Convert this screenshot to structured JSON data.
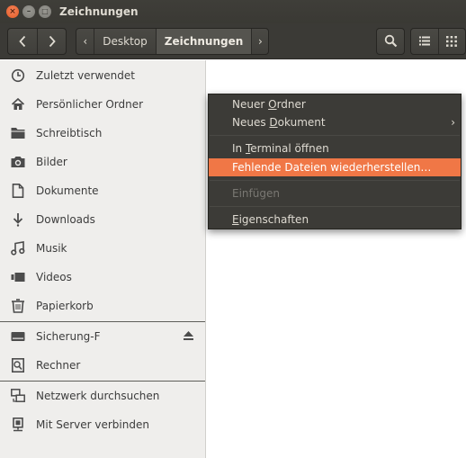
{
  "window": {
    "title": "Zeichnungen",
    "close_glyph": "×",
    "minimize_glyph": "–",
    "maximize_glyph": "□"
  },
  "toolbar": {
    "back_icon": "chevron-left-icon",
    "forward_icon": "chevron-right-icon",
    "path_left_glyph": "‹",
    "path_right_glyph": "›",
    "breadcrumbs": [
      "Desktop",
      "Zeichnungen"
    ],
    "active_crumb": "Zeichnungen",
    "search_icon": "search-icon",
    "list_view_icon": "list-view-icon",
    "grid_view_icon": "grid-view-icon"
  },
  "sidebar": {
    "items": [
      {
        "label": "Zuletzt verwendet",
        "icon": "clock-icon"
      },
      {
        "label": "Persönlicher Ordner",
        "icon": "home-icon"
      },
      {
        "label": "Schreibtisch",
        "icon": "folder-icon"
      },
      {
        "label": "Bilder",
        "icon": "camera-icon"
      },
      {
        "label": "Dokumente",
        "icon": "document-icon"
      },
      {
        "label": "Downloads",
        "icon": "download-icon"
      },
      {
        "label": "Musik",
        "icon": "music-icon"
      },
      {
        "label": "Videos",
        "icon": "video-icon"
      },
      {
        "label": "Papierkorb",
        "icon": "trash-icon"
      },
      {
        "label": "Sicherung-F",
        "icon": "drive-icon",
        "eject_icon": "eject-icon"
      },
      {
        "label": "Rechner",
        "icon": "computer-icon"
      },
      {
        "label": "Netzwerk durchsuchen",
        "icon": "network-icon"
      },
      {
        "label": "Mit Server verbinden",
        "icon": "server-icon"
      }
    ]
  },
  "context_menu": {
    "items": [
      {
        "pre": "Neuer ",
        "mnemonic": "O",
        "post": "rdner"
      },
      {
        "pre": "Neues ",
        "mnemonic": "D",
        "post": "okument",
        "submenu_glyph": "›"
      },
      {
        "pre": "In ",
        "mnemonic": "T",
        "post": "erminal öffnen"
      },
      {
        "pre": "",
        "mnemonic": "",
        "post": "Fehlende Dateien wiederherstellen…",
        "highlighted": true
      },
      {
        "pre": "",
        "mnemonic": "",
        "post": "Einfügen",
        "disabled": true
      },
      {
        "pre": "",
        "mnemonic": "E",
        "post": "igenschaften"
      }
    ]
  },
  "colors": {
    "accent": "#f07746",
    "titlebar": "#3c3b37",
    "sidebar_bg": "#efeeec",
    "menu_bg": "#3c3b37"
  }
}
